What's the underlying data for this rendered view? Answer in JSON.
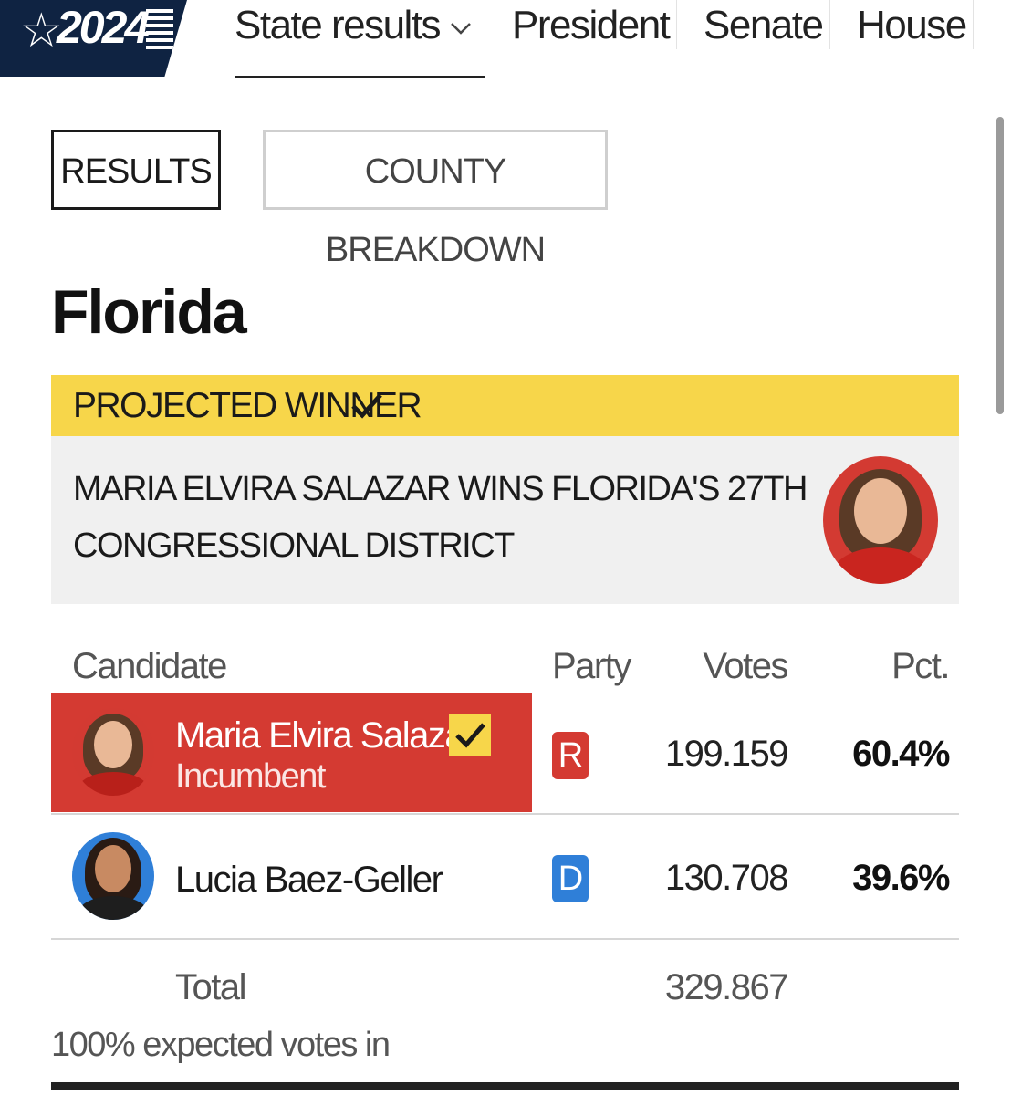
{
  "header": {
    "logo_text": "2024",
    "nav": [
      {
        "label": "State results"
      },
      {
        "label": "President"
      },
      {
        "label": "Senate"
      },
      {
        "label": "House"
      }
    ]
  },
  "tabs": {
    "results": "RESULTS",
    "county": "COUNTY BREAKDOWN"
  },
  "state": "Florida",
  "banner": {
    "label": "PROJECTED WINNER",
    "headline_line1": "MARIA ELVIRA SALAZAR WINS FLORIDA'S 27TH",
    "headline_line2": "CONGRESSIONAL DISTRICT"
  },
  "table": {
    "headers": {
      "candidate": "Candidate",
      "party": "Party",
      "votes": "Votes",
      "pct": "Pct."
    },
    "rows": [
      {
        "name": "Maria Elvira Salazar",
        "status": "Incumbent",
        "party": "R",
        "votes": "199.159",
        "pct": "60.4%"
      },
      {
        "name": "Lucia Baez-Geller",
        "status": "",
        "party": "D",
        "votes": "130.708",
        "pct": "39.6%"
      }
    ],
    "total_label": "Total",
    "total_votes": "329.867",
    "expected": "100% expected votes in"
  },
  "colors": {
    "republican": "#d43a32",
    "democrat": "#2f7fd8",
    "winner_banner": "#f7d64a",
    "navy": "#0f2342"
  }
}
